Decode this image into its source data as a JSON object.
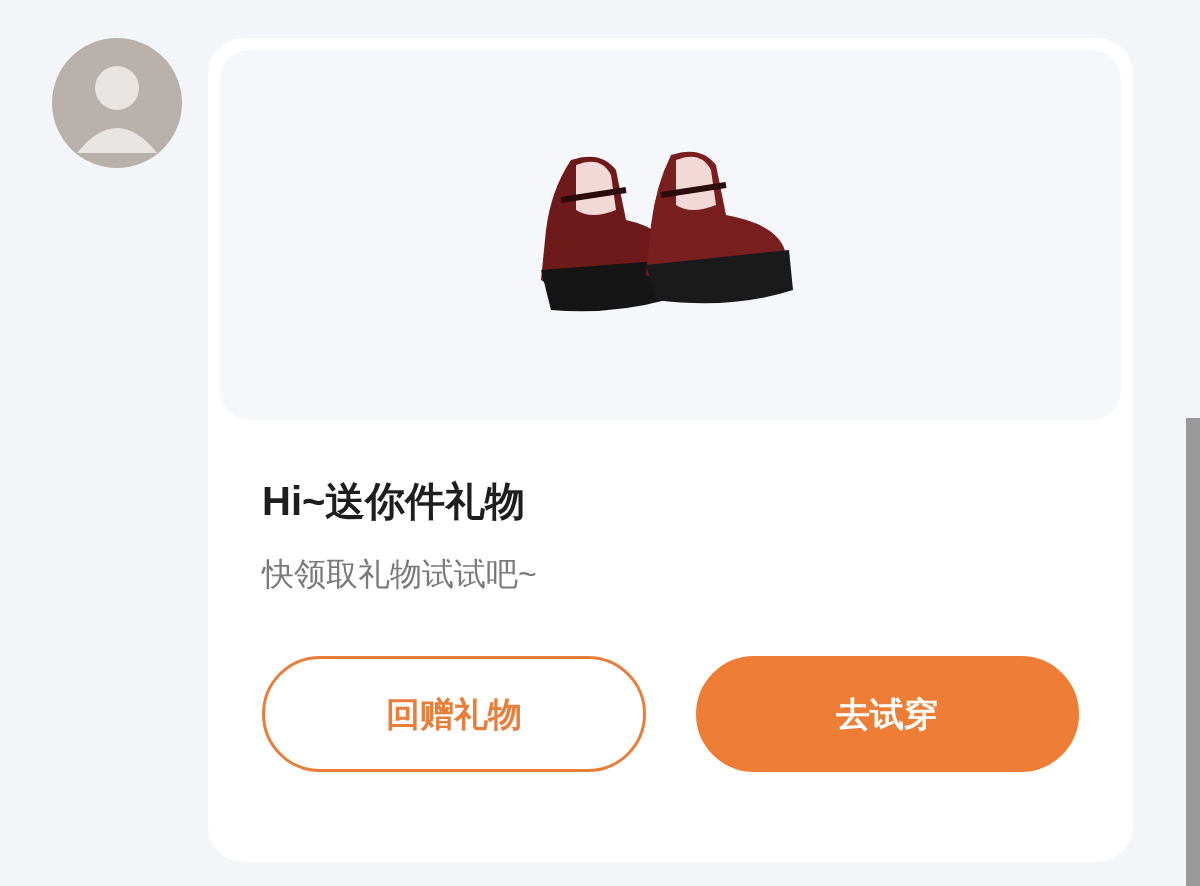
{
  "message": {
    "title": "Hi~送你件礼物",
    "subtitle": "快领取礼物试试吧~",
    "buttons": [
      {
        "label": "回赠礼物",
        "kind": "outline"
      },
      {
        "label": "去试穿",
        "kind": "filled"
      }
    ]
  }
}
